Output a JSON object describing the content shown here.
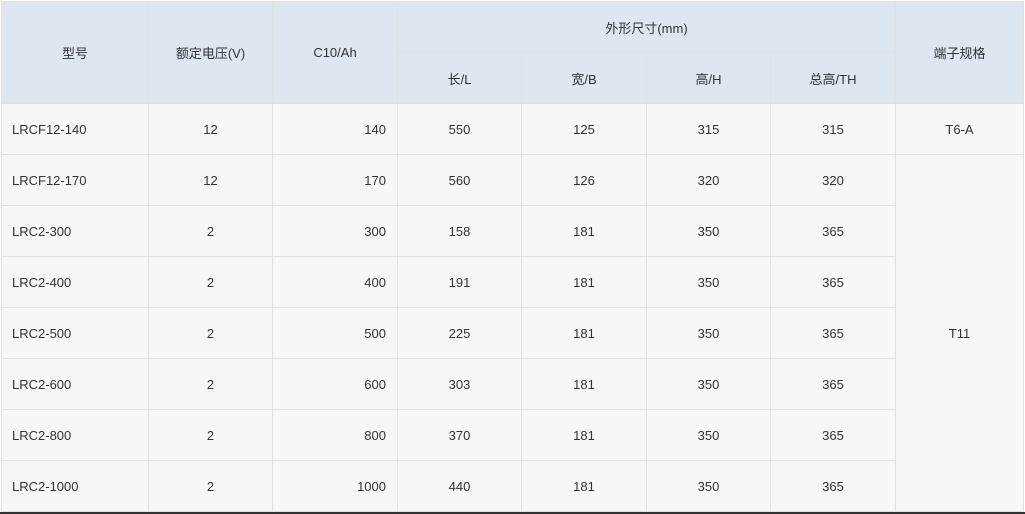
{
  "headers": {
    "model": "型号",
    "voltage": "额定电压(V)",
    "capacity": "C10/Ah",
    "dimensions": "外形尺寸(mm)",
    "length": "长/L",
    "width": "宽/B",
    "height": "高/H",
    "total_height": "总高/TH",
    "terminal": "端子规格"
  },
  "rows": [
    {
      "model": "LRCF12-140",
      "voltage": "12",
      "capacity": "140",
      "length": "550",
      "width": "125",
      "height": "315",
      "total_height": "315"
    },
    {
      "model": "LRCF12-170",
      "voltage": "12",
      "capacity": "170",
      "length": "560",
      "width": "126",
      "height": "320",
      "total_height": "320"
    },
    {
      "model": "LRC2-300",
      "voltage": "2",
      "capacity": "300",
      "length": "158",
      "width": "181",
      "height": "350",
      "total_height": "365"
    },
    {
      "model": "LRC2-400",
      "voltage": "2",
      "capacity": "400",
      "length": "191",
      "width": "181",
      "height": "350",
      "total_height": "365"
    },
    {
      "model": "LRC2-500",
      "voltage": "2",
      "capacity": "500",
      "length": "225",
      "width": "181",
      "height": "350",
      "total_height": "365"
    },
    {
      "model": "LRC2-600",
      "voltage": "2",
      "capacity": "600",
      "length": "303",
      "width": "181",
      "height": "350",
      "total_height": "365"
    },
    {
      "model": "LRC2-800",
      "voltage": "2",
      "capacity": "800",
      "length": "370",
      "width": "181",
      "height": "350",
      "total_height": "365"
    },
    {
      "model": "LRC2-1000",
      "voltage": "2",
      "capacity": "1000",
      "length": "440",
      "width": "181",
      "height": "350",
      "total_height": "365"
    }
  ],
  "terminals": {
    "first": "T6-A",
    "rest": "T11"
  }
}
